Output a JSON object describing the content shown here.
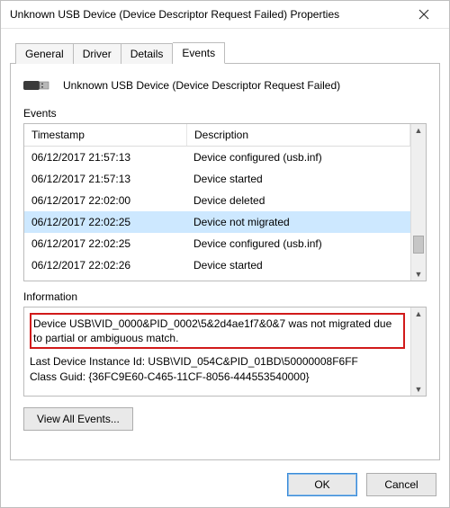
{
  "window": {
    "title": "Unknown USB Device (Device Descriptor Request Failed) Properties"
  },
  "tabs": {
    "general": "General",
    "driver": "Driver",
    "details": "Details",
    "events": "Events"
  },
  "device": {
    "name": "Unknown USB Device (Device Descriptor Request Failed)"
  },
  "events": {
    "label": "Events",
    "col_timestamp": "Timestamp",
    "col_description": "Description",
    "rows": [
      {
        "ts": "06/12/2017 21:57:13",
        "desc": "Device configured (usb.inf)"
      },
      {
        "ts": "06/12/2017 21:57:13",
        "desc": "Device started"
      },
      {
        "ts": "06/12/2017 22:02:00",
        "desc": "Device deleted"
      },
      {
        "ts": "06/12/2017 22:02:25",
        "desc": "Device not migrated"
      },
      {
        "ts": "06/12/2017 22:02:25",
        "desc": "Device configured (usb.inf)"
      },
      {
        "ts": "06/12/2017 22:02:26",
        "desc": "Device started"
      }
    ],
    "selected_index": 3
  },
  "information": {
    "label": "Information",
    "highlighted": "Device USB\\VID_0000&PID_0002\\5&2d4ae1f7&0&7 was not migrated due to partial or ambiguous match.",
    "line2": "Last Device Instance Id: USB\\VID_054C&PID_01BD\\50000008F6FF",
    "line3": "Class Guid: {36FC9E60-C465-11CF-8056-444553540000}"
  },
  "buttons": {
    "view_all": "View All Events...",
    "ok": "OK",
    "cancel": "Cancel"
  }
}
